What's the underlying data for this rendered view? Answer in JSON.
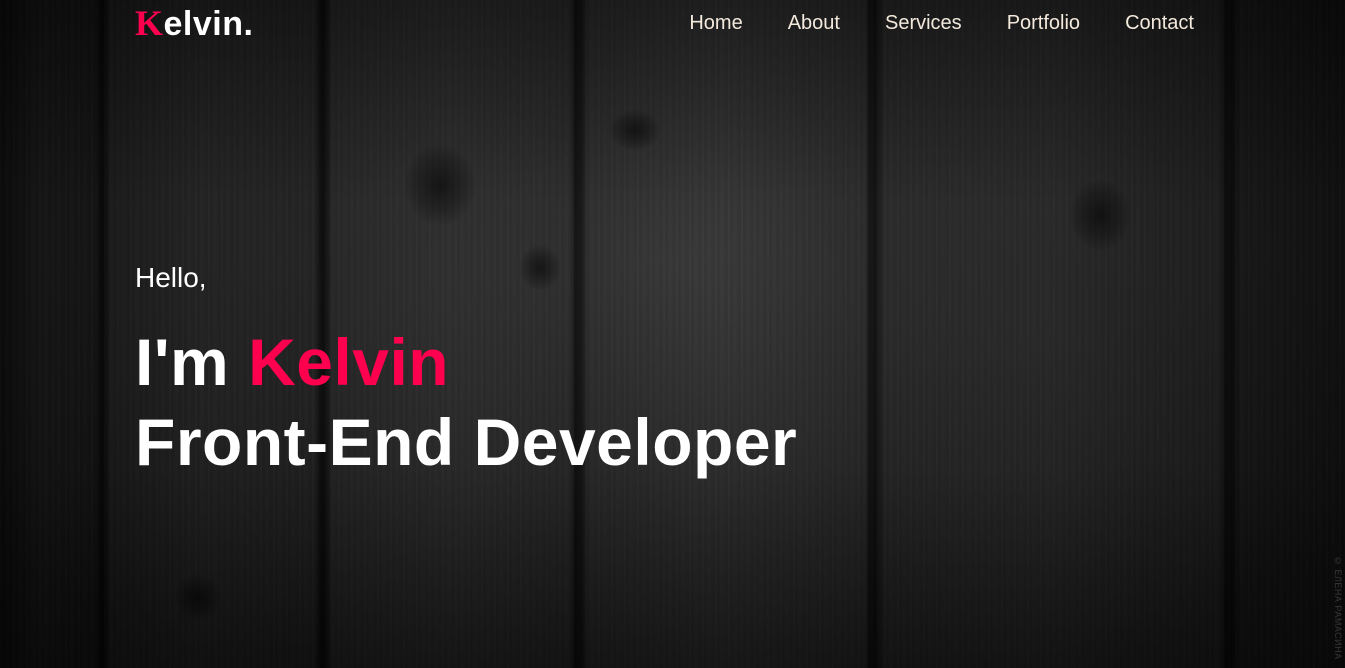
{
  "brand": {
    "logo_initial": "K",
    "logo_rest": "elvin.",
    "accent_color": "#ff004f"
  },
  "nav": {
    "items": [
      {
        "label": "Home"
      },
      {
        "label": "About"
      },
      {
        "label": "Services"
      },
      {
        "label": "Portfolio"
      },
      {
        "label": "Contact"
      }
    ]
  },
  "hero": {
    "greeting": "Hello,",
    "intro_prefix": "I'm ",
    "name": "Kelvin",
    "role": "Front-End Developer"
  },
  "background": {
    "watermark": "© ЕЛЕНА РАМАСИНА"
  }
}
